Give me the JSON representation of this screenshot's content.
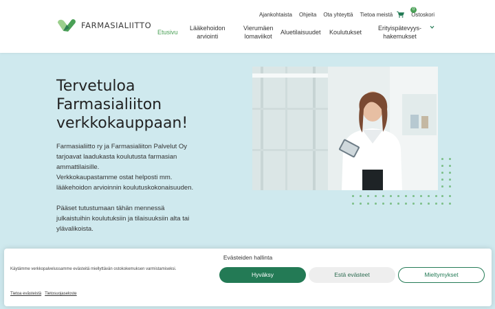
{
  "brand": {
    "name": "FARMASIALIITTO",
    "accent": "#4aa056",
    "accent_dark": "#237a55"
  },
  "topnav": {
    "items": [
      "Ajankohtaista",
      "Ohjeita",
      "Ota yhteyttä",
      "Tietoa meistä"
    ],
    "cart_count": "0",
    "cart_label": "Ostoskori"
  },
  "mainnav": {
    "items": [
      {
        "line1": "Etusivu",
        "line2": ""
      },
      {
        "line1": "Lääkehoidon",
        "line2": "arviointi"
      },
      {
        "line1": "Vierumäen",
        "line2": "lomaviikot"
      },
      {
        "line1": "Aluetilaisuudet",
        "line2": ""
      },
      {
        "line1": "Koulutukset",
        "line2": ""
      },
      {
        "line1": "Erityispätevyys-",
        "line2": "hakemukset"
      }
    ]
  },
  "hero": {
    "title_lines": [
      "Tervetuloa",
      "Farmasialiiton",
      "verkkokauppaan!"
    ],
    "para1": [
      "Farmasialiitto ry ja Farmasialiiton Palvelut Oy",
      "tarjoavat laadukasta koulutusta farmasian",
      "ammattilaisille.",
      "Verkkokaupastamme ostat helposti mm.",
      "lääkehoidon arvioinnin koulutuskokonaisuuden."
    ],
    "para2": [
      "Pääset tutustumaan tähän mennessä",
      "julkaistuihin koulutuksiin ja tilaisuuksiin alta tai",
      "ylävalikoista."
    ]
  },
  "consent": {
    "title": "Evästeiden hallinta",
    "text": "Käytämme verkkopalvelussamme evästeitä miellyttävän ostokokemuksen varmistamiseksi.",
    "accept": "Hyväksy",
    "deny": "Estä evästeet",
    "prefs": "Mieltymykset",
    "links": [
      "Tietoa evästeistä",
      "Tietosuojaseloste"
    ]
  }
}
